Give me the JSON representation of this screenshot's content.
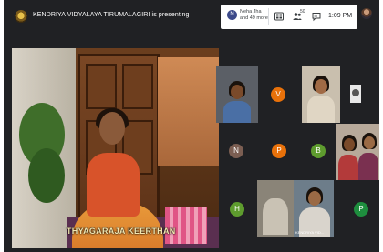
{
  "topbar": {
    "presenter_text": "KENDRIYA VIDYALAYA TIRUMALAGIRI is presenting",
    "participants_line1": "Neha Jha",
    "participants_line2": "and 49 more",
    "people_count": "50",
    "time": "1:09 PM"
  },
  "main": {
    "caption": "THYAGARAJA KEERTHAN"
  },
  "tiles": [
    {
      "type": "video",
      "name": ""
    },
    {
      "type": "letter",
      "letter": "V",
      "color": "#e8710a"
    },
    {
      "type": "video",
      "name": ""
    },
    {
      "type": "video",
      "name": ""
    },
    {
      "type": "letter",
      "letter": "N",
      "color": "#7b5e52"
    },
    {
      "type": "letter",
      "letter": "P",
      "color": "#e8710a"
    },
    {
      "type": "letter",
      "letter": "B",
      "color": "#5e9c2e"
    },
    {
      "type": "video",
      "name": ""
    },
    {
      "type": "letter",
      "letter": "H",
      "color": "#5e9c2e"
    },
    {
      "type": "video",
      "name": ""
    },
    {
      "type": "video",
      "name": "KENDRIYA VID..."
    },
    {
      "type": "letter",
      "letter": "P",
      "color": "#1e8e3e"
    }
  ],
  "icons": [
    "participants-icon",
    "people-icon",
    "chat-icon",
    "activities-icon"
  ]
}
